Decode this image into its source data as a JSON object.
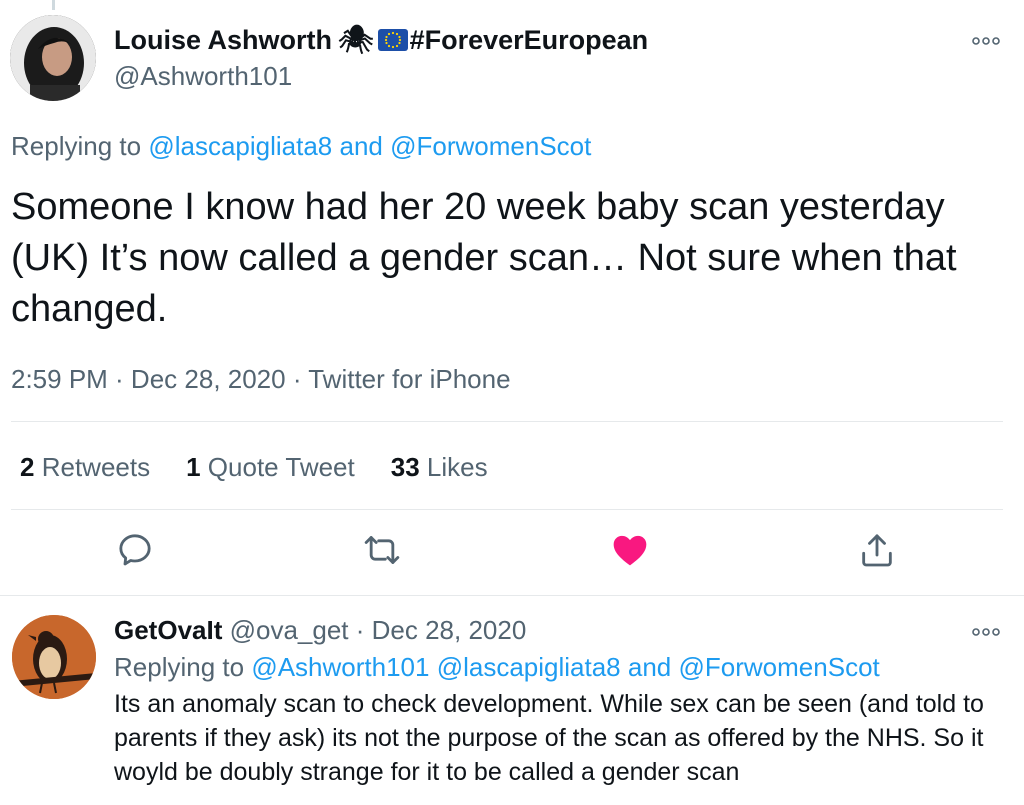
{
  "main_tweet": {
    "author_name": "Louise Ashworth",
    "name_suffix": "#ForeverEuropean",
    "handle": "@Ashworth101",
    "replying_prefix": "Replying to",
    "replying_user1": "@lascapigliata8",
    "replying_and": "and",
    "replying_user2": "@ForwomenScot",
    "text": "Someone I know had her 20 week baby scan yesterday (UK) It’s now called a gender scan… Not sure when that changed.",
    "timestamp": "2:59 PM · Dec 28, 2020 · Twitter for iPhone",
    "stats": {
      "retweets_count": "2",
      "retweets_label": "Retweets",
      "quotes_count": "1",
      "quotes_label": "Quote Tweet",
      "likes_count": "33",
      "likes_label": "Likes"
    },
    "like_color": "#f91880",
    "actions": [
      "reply-icon",
      "retweet-icon",
      "like-icon",
      "share-icon"
    ]
  },
  "reply_tweet": {
    "author_name": "GetOvaIt",
    "handle_date": "@ova_get · Dec 28, 2020",
    "replying_prefix": "Replying to",
    "replying_user1": "@Ashworth101",
    "replying_user2": "@lascapigliata8",
    "replying_and": "and",
    "replying_user3": "@ForwomenScot",
    "text": "Its an anomaly scan to check development. While sex can be seen (and told to parents if they ask) its not the purpose of the scan as offered by the NHS. So it woyld be doubly strange for it to be called a gender scan"
  },
  "colors": {
    "link": "#1d9bf0",
    "secondary_text": "#536471",
    "primary_text": "#0f1419"
  }
}
